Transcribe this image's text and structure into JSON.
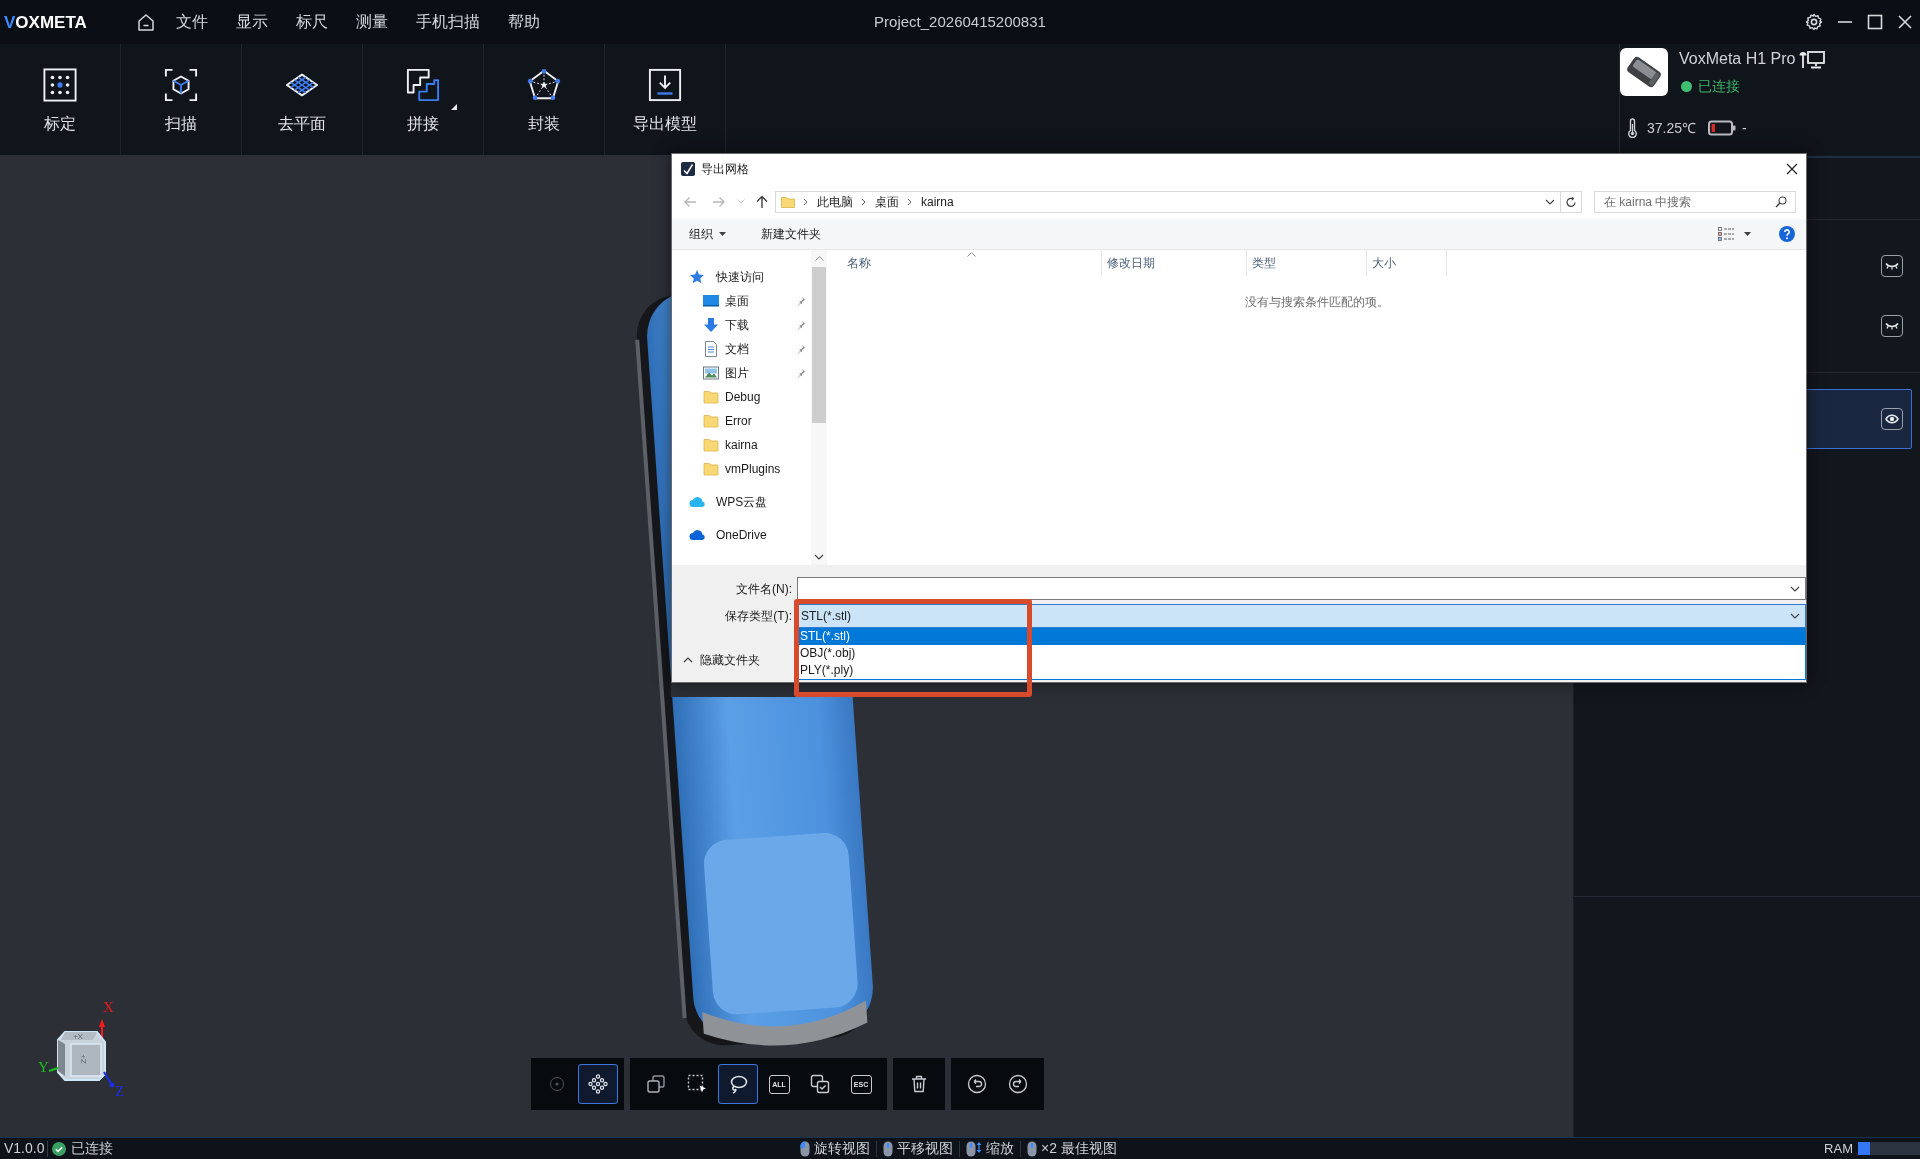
{
  "title_bar": {
    "logo": "VOXMETA",
    "menu": [
      "文件",
      "显示",
      "标尺",
      "测量",
      "手机扫描",
      "帮助"
    ],
    "title": "Project_20260415200831"
  },
  "toolbar": {
    "tools": [
      {
        "kind": "calibrate",
        "label": "标定",
        "dropdown": false
      },
      {
        "kind": "scan",
        "label": "扫描",
        "dropdown": false
      },
      {
        "kind": "plane",
        "label": "去平面",
        "dropdown": false
      },
      {
        "kind": "stitch",
        "label": "拼接",
        "dropdown": true
      },
      {
        "kind": "mesh",
        "label": "封装",
        "dropdown": false
      },
      {
        "kind": "export",
        "label": "导出模型",
        "dropdown": false
      }
    ]
  },
  "device": {
    "name": "VoxMeta H1 Pro",
    "status": "已连接",
    "temperature": "37.25℃",
    "battery": "-"
  },
  "layer_panel": {
    "groups": [
      {
        "items": [
          {
            "visible": false,
            "selected": false
          },
          {
            "visible": false,
            "selected": false
          }
        ]
      },
      {
        "items": [
          {
            "visible": true,
            "selected": true
          }
        ]
      }
    ]
  },
  "view_gizmo": {
    "axes": [
      {
        "label": "X",
        "color": "#e81818"
      },
      {
        "label": "Y",
        "color": "#1ec21e"
      },
      {
        "label": "Z",
        "color": "#1a2ee6"
      }
    ],
    "face_labels": [
      "X+",
      "Z+"
    ]
  },
  "bottom_toolbar": {
    "groups": [
      {
        "tools": [
          {
            "kind": "point",
            "selected": false,
            "disabled": true
          },
          {
            "kind": "point-cloud",
            "selected": true,
            "disabled": false
          }
        ]
      },
      {
        "tools": [
          {
            "kind": "copy",
            "selected": false,
            "disabled": false
          },
          {
            "kind": "box-select",
            "selected": false,
            "disabled": false
          },
          {
            "kind": "lasso",
            "selected": true,
            "disabled": false
          },
          {
            "kind": "select-all",
            "label": "ALL",
            "selected": false,
            "disabled": false
          },
          {
            "kind": "invert",
            "selected": false,
            "disabled": false
          },
          {
            "kind": "clear",
            "label": "ESC",
            "selected": false,
            "disabled": false
          }
        ]
      },
      {
        "tools": [
          {
            "kind": "delete",
            "selected": false,
            "disabled": false
          }
        ]
      },
      {
        "tools": [
          {
            "kind": "undo",
            "selected": false,
            "disabled": false
          },
          {
            "kind": "redo",
            "selected": false,
            "disabled": false
          }
        ]
      }
    ]
  },
  "save_dialog": {
    "title": "导出网格",
    "path": [
      "此电脑",
      "桌面",
      "kairna"
    ],
    "search_placeholder": "在 kairna 中搜索",
    "commands": [
      {
        "label": "组织",
        "dropdown": true
      },
      {
        "label": "新建文件夹",
        "dropdown": false
      }
    ],
    "nav": [
      {
        "kind": "quick-access",
        "label": "快速访问",
        "children": [
          {
            "kind": "desktop",
            "label": "桌面",
            "pinned": true
          },
          {
            "kind": "downloads",
            "label": "下载",
            "pinned": true
          },
          {
            "kind": "documents",
            "label": "文档",
            "pinned": true
          },
          {
            "kind": "pictures",
            "label": "图片",
            "pinned": true
          },
          {
            "kind": "folder",
            "label": "Debug",
            "pinned": false
          },
          {
            "kind": "folder",
            "label": "Error",
            "pinned": false
          },
          {
            "kind": "folder",
            "label": "kairna",
            "pinned": false
          },
          {
            "kind": "folder",
            "label": "vmPlugins",
            "pinned": false
          }
        ]
      },
      {
        "kind": "wps-cloud",
        "label": "WPS云盘"
      },
      {
        "kind": "onedrive",
        "label": "OneDrive"
      }
    ],
    "columns": [
      {
        "label": "名称",
        "sorted": true
      },
      {
        "label": "修改日期",
        "sorted": false
      },
      {
        "label": "类型",
        "sorted": false
      },
      {
        "label": "大小",
        "sorted": false
      }
    ],
    "empty_message": "没有与搜索条件匹配的项。",
    "file_name": {
      "label": "文件名(N):"
    },
    "save_type": {
      "label": "保存类型(T):",
      "value": "STL(*.stl)",
      "expanded": true,
      "highlighted": true,
      "options": [
        {
          "label": "STL(*.stl)",
          "selected": true
        },
        {
          "label": "OBJ(*.obj)",
          "selected": false
        },
        {
          "label": "PLY(*.ply)",
          "selected": false
        }
      ]
    },
    "hide_folders": "隐藏文件夹"
  },
  "status_bar": {
    "version": "V1.0.0",
    "connection": "已连接",
    "hints": [
      {
        "kind": "left",
        "label": "旋转视图"
      },
      {
        "kind": "middle",
        "label": "平移视图"
      },
      {
        "kind": "wheel",
        "label": "缩放"
      },
      {
        "kind": "middle",
        "label": "×2 最佳视图"
      }
    ],
    "ram": {
      "label": "RAM",
      "level": 0.2
    }
  }
}
